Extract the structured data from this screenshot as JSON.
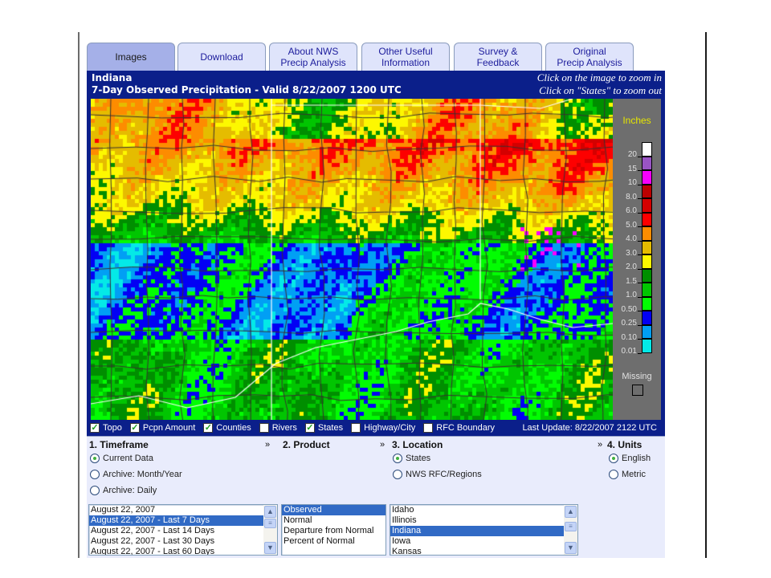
{
  "tabs": [
    {
      "label": "Images",
      "active": true
    },
    {
      "label": "Download",
      "active": false
    },
    {
      "label": "About NWS\nPrecip Analysis",
      "active": false
    },
    {
      "label": "Other Useful\nInformation",
      "active": false
    },
    {
      "label": "Survey &\nFeedback",
      "active": false
    },
    {
      "label": "Original\nPrecip Analysis",
      "active": false
    }
  ],
  "header": {
    "location": "Indiana",
    "title": "7-Day Observed Precipitation - Valid 8/22/2007 1200 UTC",
    "hint_zoom_in": "Click on the image to zoom in",
    "hint_zoom_out": "Click on \"States\" to zoom out"
  },
  "legend": {
    "title": "Inches",
    "bins": [
      {
        "label": "20",
        "color": "#ffffff"
      },
      {
        "label": "15",
        "color": "#9954c4"
      },
      {
        "label": "10",
        "color": "#f800fd"
      },
      {
        "label": "8.0",
        "color": "#bc0000"
      },
      {
        "label": "6.0",
        "color": "#d40000"
      },
      {
        "label": "5.0",
        "color": "#fd0000"
      },
      {
        "label": "4.0",
        "color": "#fd8c00"
      },
      {
        "label": "3.0",
        "color": "#e5bc00"
      },
      {
        "label": "2.0",
        "color": "#fdf800"
      },
      {
        "label": "1.5",
        "color": "#008e00"
      },
      {
        "label": "1.0",
        "color": "#01c501"
      },
      {
        "label": "0.50",
        "color": "#02fd02"
      },
      {
        "label": "0.25",
        "color": "#0300f4"
      },
      {
        "label": "0.10",
        "color": "#019ff4"
      },
      {
        "label": "0.01",
        "color": "#04e9e7"
      }
    ],
    "missing_label": "Missing"
  },
  "overlays": [
    {
      "label": "Topo",
      "checked": true
    },
    {
      "label": "Pcpn Amount",
      "checked": true
    },
    {
      "label": "Counties",
      "checked": true
    },
    {
      "label": "Rivers",
      "checked": false
    },
    {
      "label": "States",
      "checked": true
    },
    {
      "label": "Highway/City",
      "checked": false
    },
    {
      "label": "RFC Boundary",
      "checked": false
    }
  ],
  "last_update": "Last Update: 8/22/2007 2122 UTC",
  "sections": {
    "timeframe": {
      "title": "1. Timeframe",
      "options": [
        {
          "label": "Current Data",
          "selected": true
        },
        {
          "label": "Archive: Month/Year",
          "selected": false
        },
        {
          "label": "Archive: Daily",
          "selected": false
        }
      ],
      "list": [
        {
          "label": "August 22, 2007",
          "selected": false
        },
        {
          "label": "August 22, 2007 - Last 7 Days",
          "selected": true
        },
        {
          "label": "August 22, 2007 - Last 14 Days",
          "selected": false
        },
        {
          "label": "August 22, 2007 - Last 30 Days",
          "selected": false
        },
        {
          "label": "August 22, 2007 - Last 60 Days",
          "selected": false
        }
      ]
    },
    "product": {
      "title": "2. Product",
      "list": [
        {
          "label": "Observed",
          "selected": true
        },
        {
          "label": "Normal",
          "selected": false
        },
        {
          "label": "Departure from Normal",
          "selected": false
        },
        {
          "label": "Percent of Normal",
          "selected": false
        }
      ]
    },
    "location": {
      "title": "3. Location",
      "options": [
        {
          "label": "States",
          "selected": true
        },
        {
          "label": "NWS RFC/Regions",
          "selected": false
        }
      ],
      "list": [
        {
          "label": "Idaho",
          "selected": false
        },
        {
          "label": "Illinois",
          "selected": false
        },
        {
          "label": "Indiana",
          "selected": true
        },
        {
          "label": "Iowa",
          "selected": false
        },
        {
          "label": "Kansas",
          "selected": false
        }
      ]
    },
    "units": {
      "title": "4. Units",
      "options": [
        {
          "label": "English",
          "selected": true
        },
        {
          "label": "Metric",
          "selected": false
        }
      ]
    }
  },
  "raquo": "»"
}
